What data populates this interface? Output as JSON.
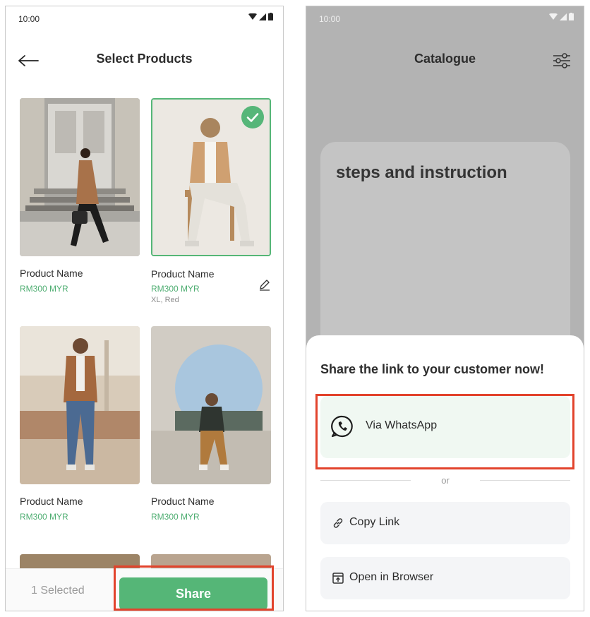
{
  "left_screen": {
    "status_time": "10:00",
    "title": "Select Products",
    "products": [
      {
        "name": "Product Name",
        "price": "RM300 MYR",
        "variant": "",
        "selected": false
      },
      {
        "name": "Product Name",
        "price": "RM300 MYR",
        "variant": "XL, Red",
        "selected": true
      },
      {
        "name": "Product Name",
        "price": "RM300 MYR",
        "variant": "",
        "selected": false
      },
      {
        "name": "Product Name",
        "price": "RM300 MYR",
        "variant": "",
        "selected": false
      }
    ],
    "selected_count": "1 Selected",
    "share_label": "Share"
  },
  "right_screen": {
    "status_time": "10:00",
    "title": "Catalogue",
    "card_text": "steps and instruction",
    "sheet_title": "Share the link to your customer now!",
    "whatsapp_label": "Via WhatsApp",
    "divider_text": "or",
    "copy_link_label": "Copy Link",
    "open_browser_label": "Open in Browser"
  },
  "colors": {
    "accent_green": "#55b677",
    "price_green": "#4fae72",
    "highlight_red": "#e2432c",
    "overlay_grey": "#b3b3b3"
  },
  "icons": [
    "back-arrow-icon",
    "wifi-icon",
    "signal-icon",
    "battery-icon",
    "check-icon",
    "edit-pencil-icon",
    "filter-sliders-icon",
    "whatsapp-icon",
    "link-icon",
    "external-browser-icon"
  ]
}
